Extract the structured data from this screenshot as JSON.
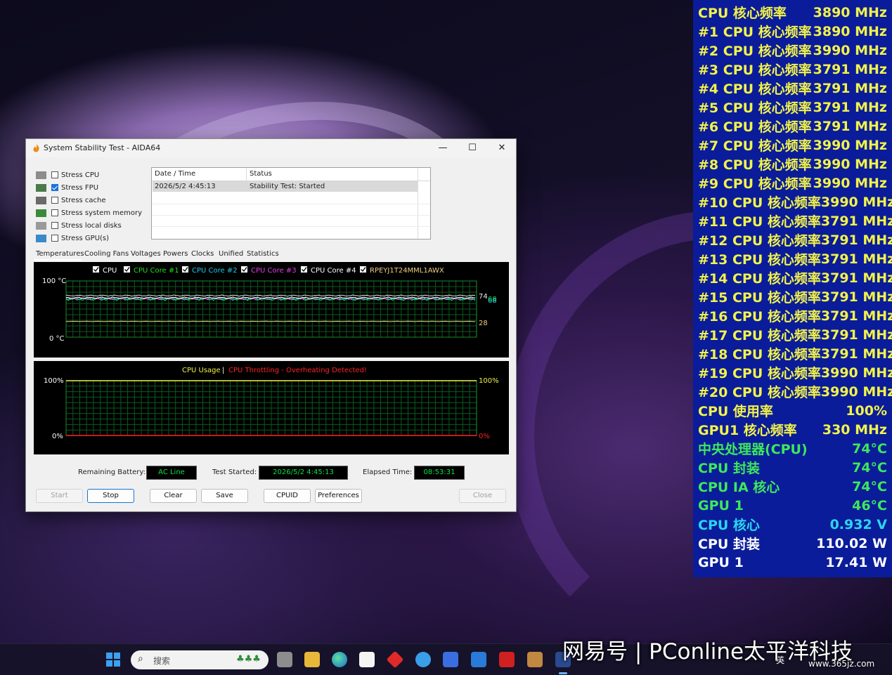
{
  "window": {
    "title": "System Stability Test - AIDA64",
    "minimize_glyph": "—",
    "maximize_glyph": "☐",
    "close_glyph": "✕",
    "stress_options": [
      {
        "label": "Stress CPU",
        "checked": false,
        "icon": "cpu-chip-icon"
      },
      {
        "label": "Stress FPU",
        "checked": true,
        "icon": "fpu-123-icon"
      },
      {
        "label": "Stress cache",
        "checked": false,
        "icon": "cache-chip-icon"
      },
      {
        "label": "Stress system memory",
        "checked": false,
        "icon": "memory-stick-icon"
      },
      {
        "label": "Stress local disks",
        "checked": false,
        "icon": "disk-icon"
      },
      {
        "label": "Stress GPU(s)",
        "checked": false,
        "icon": "gpu-icon"
      }
    ],
    "log": {
      "columns": [
        "Date / Time",
        "Status"
      ],
      "rows": [
        [
          "2026/5/2 4:45:13",
          "Stability Test: Started"
        ]
      ]
    },
    "tabs": [
      "Temperatures",
      "Cooling Fans",
      "Voltages",
      "Powers",
      "Clocks",
      "Unified",
      "Statistics"
    ],
    "temp_graph": {
      "legend": [
        {
          "label": "CPU",
          "color": "#ffffff",
          "checked": true
        },
        {
          "label": "CPU Core #1",
          "color": "#22dd22",
          "checked": true
        },
        {
          "label": "CPU Core #2",
          "color": "#22c8e8",
          "checked": true
        },
        {
          "label": "CPU Core #3",
          "color": "#e040e0",
          "checked": true
        },
        {
          "label": "CPU Core #4",
          "color": "#ffffff",
          "checked": true
        },
        {
          "label": "RPEYJ1T24MML1AWX",
          "color": "#f0d080",
          "checked": true
        }
      ],
      "y_top": "100 °C",
      "y_bottom": "0 °C",
      "right_labels": [
        "74",
        "68",
        "68",
        "28"
      ]
    },
    "usage_graph": {
      "title_usage": "CPU Usage",
      "separator": "|",
      "title_throttle": "CPU Throttling - Overheating Detected!",
      "y_top": "100%",
      "y_bottom": "0%",
      "right_top": "100%",
      "right_bottom": "0%"
    },
    "status": {
      "battery_label": "Remaining Battery:",
      "battery_value": "AC Line",
      "started_label": "Test Started:",
      "started_value": "2026/5/2 4:45:13",
      "elapsed_label": "Elapsed Time:",
      "elapsed_value": "08:53:31"
    },
    "buttons": {
      "start": "Start",
      "stop": "Stop",
      "clear": "Clear",
      "save": "Save",
      "cpuid": "CPUID",
      "preferences": "Preferences",
      "close": "Close"
    }
  },
  "osd": {
    "rows": [
      {
        "label": "CPU 核心频率",
        "value": "3890 MHz",
        "color": "#f2f24a"
      },
      {
        "label": "#1 CPU 核心频率",
        "value": "3890 MHz",
        "color": "#f2f24a"
      },
      {
        "label": "#2 CPU 核心频率",
        "value": "3990 MHz",
        "color": "#f2f24a"
      },
      {
        "label": "#3 CPU 核心频率",
        "value": "3791 MHz",
        "color": "#f2f24a"
      },
      {
        "label": "#4 CPU 核心频率",
        "value": "3791 MHz",
        "color": "#f2f24a"
      },
      {
        "label": "#5 CPU 核心频率",
        "value": "3791 MHz",
        "color": "#f2f24a"
      },
      {
        "label": "#6 CPU 核心频率",
        "value": "3791 MHz",
        "color": "#f2f24a"
      },
      {
        "label": "#7 CPU 核心频率",
        "value": "3990 MHz",
        "color": "#f2f24a"
      },
      {
        "label": "#8 CPU 核心频率",
        "value": "3990 MHz",
        "color": "#f2f24a"
      },
      {
        "label": "#9 CPU 核心频率",
        "value": "3990 MHz",
        "color": "#f2f24a"
      },
      {
        "label": "#10 CPU 核心频率",
        "value": "3990 MHz",
        "color": "#f2f24a"
      },
      {
        "label": "#11 CPU 核心频率",
        "value": "3791 MHz",
        "color": "#f2f24a"
      },
      {
        "label": "#12 CPU 核心频率",
        "value": "3791 MHz",
        "color": "#f2f24a"
      },
      {
        "label": "#13 CPU 核心频率",
        "value": "3791 MHz",
        "color": "#f2f24a"
      },
      {
        "label": "#14 CPU 核心频率",
        "value": "3791 MHz",
        "color": "#f2f24a"
      },
      {
        "label": "#15 CPU 核心频率",
        "value": "3791 MHz",
        "color": "#f2f24a"
      },
      {
        "label": "#16 CPU 核心频率",
        "value": "3791 MHz",
        "color": "#f2f24a"
      },
      {
        "label": "#17 CPU 核心频率",
        "value": "3791 MHz",
        "color": "#f2f24a"
      },
      {
        "label": "#18 CPU 核心频率",
        "value": "3791 MHz",
        "color": "#f2f24a"
      },
      {
        "label": "#19 CPU 核心频率",
        "value": "3990 MHz",
        "color": "#f2f24a"
      },
      {
        "label": "#20 CPU 核心频率",
        "value": "3990 MHz",
        "color": "#f2f24a"
      },
      {
        "label": "CPU 使用率",
        "value": "100%",
        "color": "#f2f24a"
      },
      {
        "label": "GPU1 核心频率",
        "value": "330 MHz",
        "color": "#f2f24a"
      },
      {
        "label": "中央处理器(CPU)",
        "value": "74°C",
        "color": "#3ee85a"
      },
      {
        "label": "CPU 封装",
        "value": "74°C",
        "color": "#3ee85a"
      },
      {
        "label": "CPU IA 核心",
        "value": "74°C",
        "color": "#3ee85a"
      },
      {
        "label": "GPU 1",
        "value": "46°C",
        "color": "#3ee85a"
      },
      {
        "label": "CPU 核心",
        "value": "0.932 V",
        "color": "#2ad6f0"
      },
      {
        "label": "CPU 封装",
        "value": "110.02 W",
        "color": "#ffffff"
      },
      {
        "label": "GPU 1",
        "value": "17.41 W",
        "color": "#ffffff"
      }
    ]
  },
  "taskbar": {
    "search_placeholder": "搜索",
    "watermark": "网易号 | PConline太平洋科技",
    "watermark_url": "www.365jz.com",
    "ime": "英"
  }
}
